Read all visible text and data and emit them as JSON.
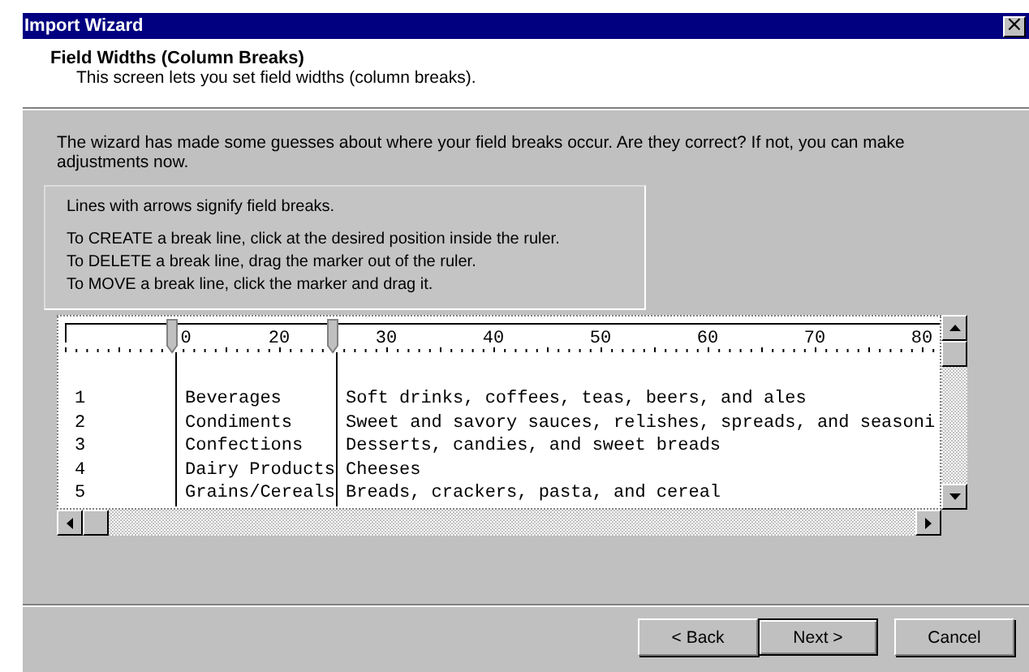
{
  "window": {
    "title": "Import Wizard",
    "close_glyph": "×"
  },
  "header": {
    "title": "Field Widths (Column Breaks)",
    "subtitle": "This screen lets you set field widths (column breaks)."
  },
  "intro": "The wizard has made some guesses about where your field breaks occur.  Are they correct?  If not, you can make adjustments now.",
  "instructions": [
    "Lines with arrows signify field breaks.",
    "To CREATE a break line, click at the desired position inside the ruler.",
    "To DELETE a break line, drag the marker out of the ruler.",
    "To MOVE a break line, click the marker and drag it."
  ],
  "ruler": {
    "labels": [
      "0",
      "20",
      "30",
      "40",
      "50",
      "60",
      "70",
      "80"
    ]
  },
  "rows": [
    {
      "cells": [
        "1",
        "Beverages",
        "Soft drinks, coffees, teas, beers, and ales"
      ]
    },
    {
      "cells": [
        "2",
        "Condiments",
        "Sweet and savory sauces, relishes, spreads, and seasoni"
      ]
    },
    {
      "cells": [
        "3",
        "Confections",
        "Desserts, candies, and sweet breads"
      ]
    },
    {
      "cells": [
        "4",
        "Dairy Products",
        "Cheeses"
      ]
    },
    {
      "cells": [
        "5",
        "Grains/Cereals",
        "Breads, crackers, pasta, and cereal"
      ]
    }
  ],
  "buttons": [
    {
      "label": "< Back",
      "default": false
    },
    {
      "label": "Next >",
      "default": true
    },
    {
      "label": "Cancel",
      "default": false
    }
  ]
}
